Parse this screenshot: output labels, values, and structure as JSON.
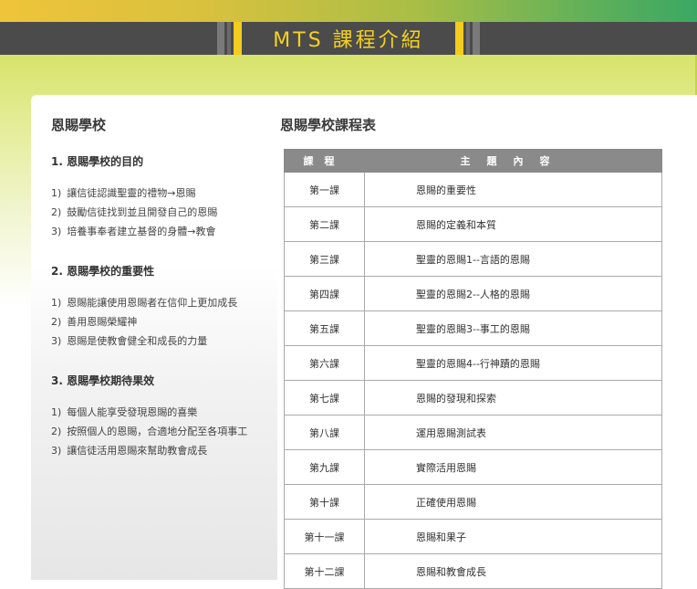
{
  "header": {
    "title": "MTS 課程介紹"
  },
  "left": {
    "title": "恩賜學校",
    "sections": [
      {
        "heading": "1. 恩賜學校的目的",
        "items": [
          {
            "num": "1)",
            "text": "讓信徒認識聖靈的禮物→恩賜"
          },
          {
            "num": "2)",
            "text": "鼓勵信徒找到並且開發自己的恩賜"
          },
          {
            "num": "3)",
            "text": "培養事奉者建立基督的身體→教會"
          }
        ]
      },
      {
        "heading": "2. 恩賜學校的重要性",
        "items": [
          {
            "num": "1)",
            "text": "恩賜能讓使用恩賜者在信仰上更加成長"
          },
          {
            "num": "2)",
            "text": "善用恩賜榮耀神"
          },
          {
            "num": "3)",
            "text": "恩賜是使教會健全和成長的力量"
          }
        ]
      },
      {
        "heading": "3. 恩賜學校期待果效",
        "items": [
          {
            "num": "1)",
            "text": "每個人能享受發現恩賜的喜樂"
          },
          {
            "num": "2)",
            "text": "按照個人的恩賜，合適地分配至各項事工"
          },
          {
            "num": "3)",
            "text": "讓信徒活用恩賜來幫助教會成長"
          }
        ]
      }
    ]
  },
  "schedule": {
    "title": "恩賜學校課程表",
    "col_course": "課程",
    "col_topic": "主題內容",
    "rows": [
      {
        "course": "第一課",
        "topic": "恩賜的重要性"
      },
      {
        "course": "第二課",
        "topic": "恩賜的定義和本質"
      },
      {
        "course": "第三課",
        "topic": "聖靈的恩賜1--言語的恩賜"
      },
      {
        "course": "第四課",
        "topic": "聖靈的恩賜2--人格的恩賜"
      },
      {
        "course": "第五課",
        "topic": "聖靈的恩賜3--事工的恩賜"
      },
      {
        "course": "第六課",
        "topic": "聖靈的恩賜4--行神蹟的恩賜"
      },
      {
        "course": "第七課",
        "topic": "恩賜的發現和探索"
      },
      {
        "course": "第八課",
        "topic": "運用恩賜測試表"
      },
      {
        "course": "第九課",
        "topic": "實際活用恩賜"
      },
      {
        "course": "第十課",
        "topic": "正確使用恩賜"
      },
      {
        "course": "第十一課",
        "topic": "恩賜和果子"
      },
      {
        "course": "第十二課",
        "topic": "恩賜和教會成長"
      }
    ]
  }
}
